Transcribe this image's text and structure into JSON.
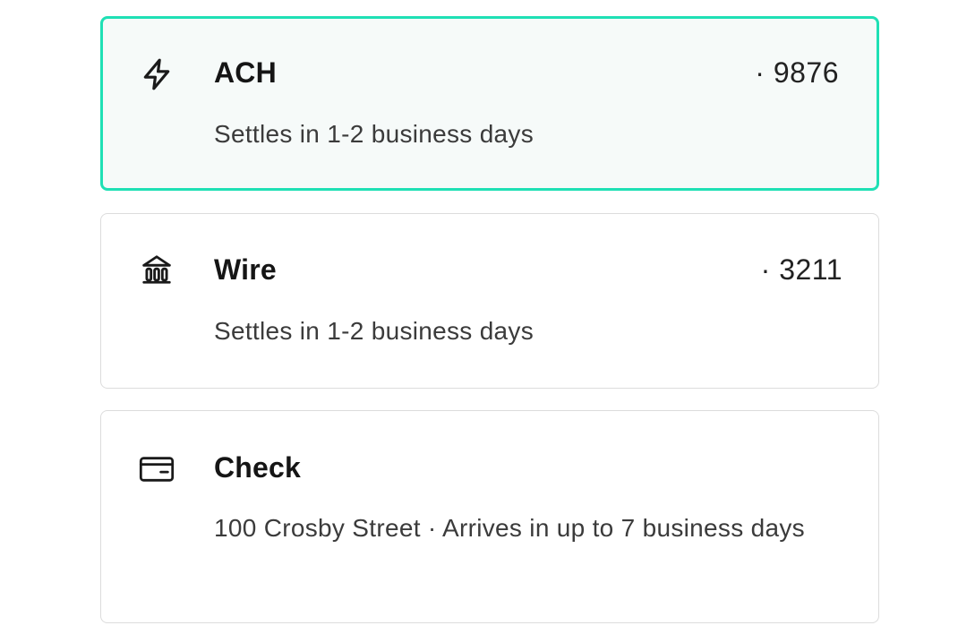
{
  "methods": [
    {
      "title": "ACH",
      "account_suffix": "· 9876",
      "subtitle": "Settles in 1-2 business days",
      "icon": "lightning-icon",
      "selected": true
    },
    {
      "title": "Wire",
      "account_suffix": "· 3211",
      "subtitle": "Settles in 1-2 business days",
      "icon": "bank-icon",
      "selected": false
    },
    {
      "title": "Check",
      "account_suffix": "",
      "subtitle": "100 Crosby Street ·  Arrives in up to 7 business days",
      "icon": "check-icon",
      "selected": false
    }
  ],
  "colors": {
    "selected_border": "#1fe0b5",
    "selected_background": "#f6faf9",
    "card_border": "#dcdcdc"
  }
}
